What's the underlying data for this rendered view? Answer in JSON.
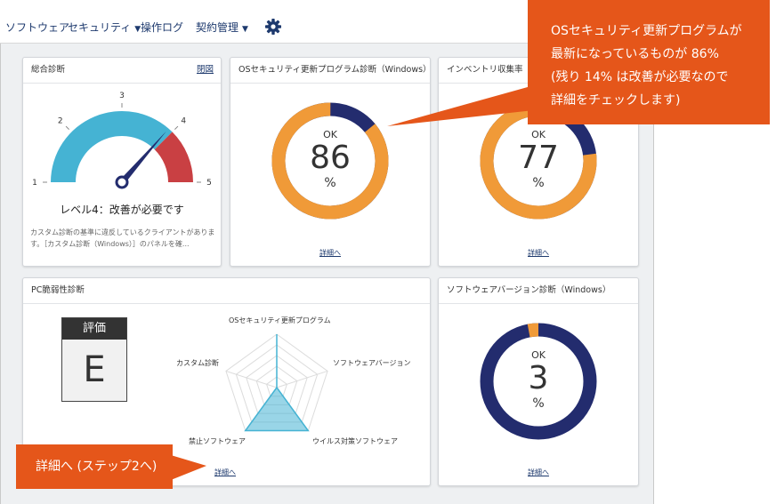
{
  "nav": {
    "items": [
      {
        "label": "ソフトウェア"
      },
      {
        "label": "セキュリティ"
      },
      {
        "label": "操作ログ"
      },
      {
        "label": "契約管理"
      }
    ],
    "caret": "▼"
  },
  "panels": {
    "overall": {
      "title": "総合診断",
      "link": "閉図",
      "level_text": "レベル4：改善が必要です",
      "description": "カスタム診断の基準に違反しているクライアントがあります。［カスタム診断（Windows）］のパネルを確...",
      "gauge": {
        "level": 4,
        "ticks": [
          "1",
          "2",
          "3",
          "4",
          "5"
        ]
      }
    },
    "os_update": {
      "title": "OSセキュリティ更新プログラム診断（Windows）",
      "ok_label": "OK",
      "value": 86,
      "unit": "%",
      "link": "詳細へ"
    },
    "inventory": {
      "title": "インベントリ収集率",
      "ok_label": "OK",
      "value": 77,
      "unit": "%",
      "link": "詳細へ"
    },
    "pc_vuln": {
      "title": "PC脆弱性診断",
      "grade_label": "評価",
      "grade": "E",
      "link": "詳細へ",
      "radar_labels": [
        "OSセキュリティ更新プログラム",
        "ソフトウェアバージョン",
        "ウイルス対策ソフトウェア",
        "禁止ソフトウェア",
        "カスタム診断"
      ]
    },
    "sw_version": {
      "title": "ソフトウェアバージョン診断（Windows）",
      "ok_label": "OK",
      "value": 3,
      "unit": "%",
      "link": "詳細へ"
    }
  },
  "callouts": {
    "top_right": [
      "OSセキュリティ更新プログラムが",
      "最新になっているものが 86%",
      "(残り 14% は改善が必要なので",
      "詳細をチェックします)"
    ],
    "bottom_left": "詳細へ (ステップ2へ)"
  },
  "colors": {
    "ok": "#f09a38",
    "ng": "#232c6e",
    "gauge_blue": "#45b3d3",
    "gauge_red": "#c94043",
    "callout": "#e5561a",
    "nav_text": "#1e3a6e"
  }
}
